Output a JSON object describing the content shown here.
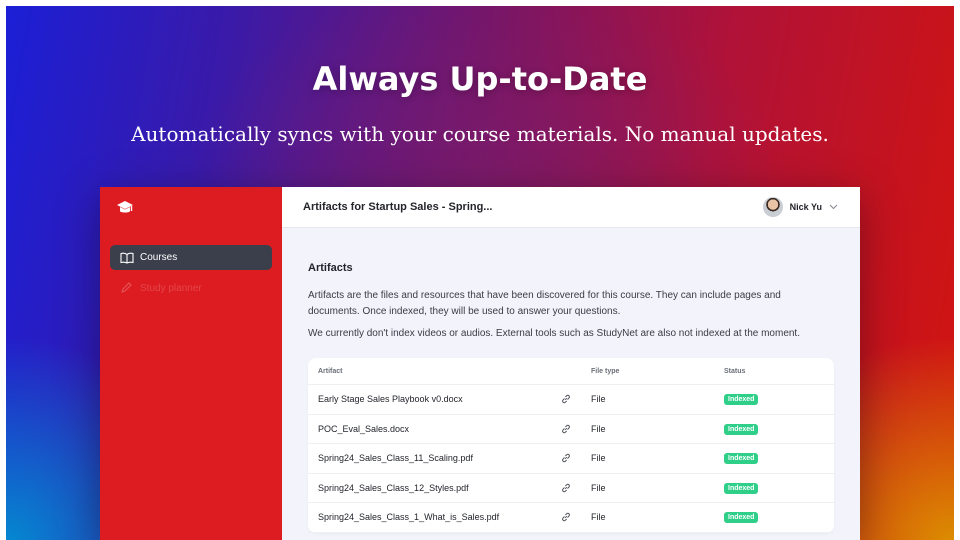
{
  "hero": {
    "headline": "Always Up-to-Date",
    "subline": "Automatically syncs with your course materials. No manual updates."
  },
  "sidebar": {
    "logo_icon": "graduation-cap-icon",
    "items": [
      {
        "label": "Courses",
        "icon": "book-icon",
        "active": true
      },
      {
        "label": "Study planner",
        "icon": "edit-icon",
        "active": false
      }
    ]
  },
  "header": {
    "title": "Artifacts for Startup Sales - Spring...",
    "user_name": "Nick Yu"
  },
  "artifacts": {
    "title": "Artifacts",
    "description": "Artifacts are the files and resources that have been discovered for this course. They can include pages and documents. Once indexed, they will be used to answer your questions.",
    "note": "We currently don't index videos or audios. External tools such as StudyNet are also not indexed at the moment.",
    "columns": [
      "Artifact",
      "File type",
      "Status"
    ],
    "rows": [
      {
        "name": "Early Stage Sales Playbook v0.docx",
        "type": "File",
        "status": "Indexed"
      },
      {
        "name": "POC_Eval_Sales.docx",
        "type": "File",
        "status": "Indexed"
      },
      {
        "name": "Spring24_Sales_Class_11_Scaling.pdf",
        "type": "File",
        "status": "Indexed"
      },
      {
        "name": "Spring24_Sales_Class_12_Styles.pdf",
        "type": "File",
        "status": "Indexed"
      },
      {
        "name": "Spring24_Sales_Class_1_What_is_Sales.pdf",
        "type": "File",
        "status": "Indexed"
      }
    ]
  },
  "colors": {
    "sidebar": "#dd1c22",
    "active_nav": "#3a3f4b",
    "indexed_badge": "#2fcf8a"
  }
}
